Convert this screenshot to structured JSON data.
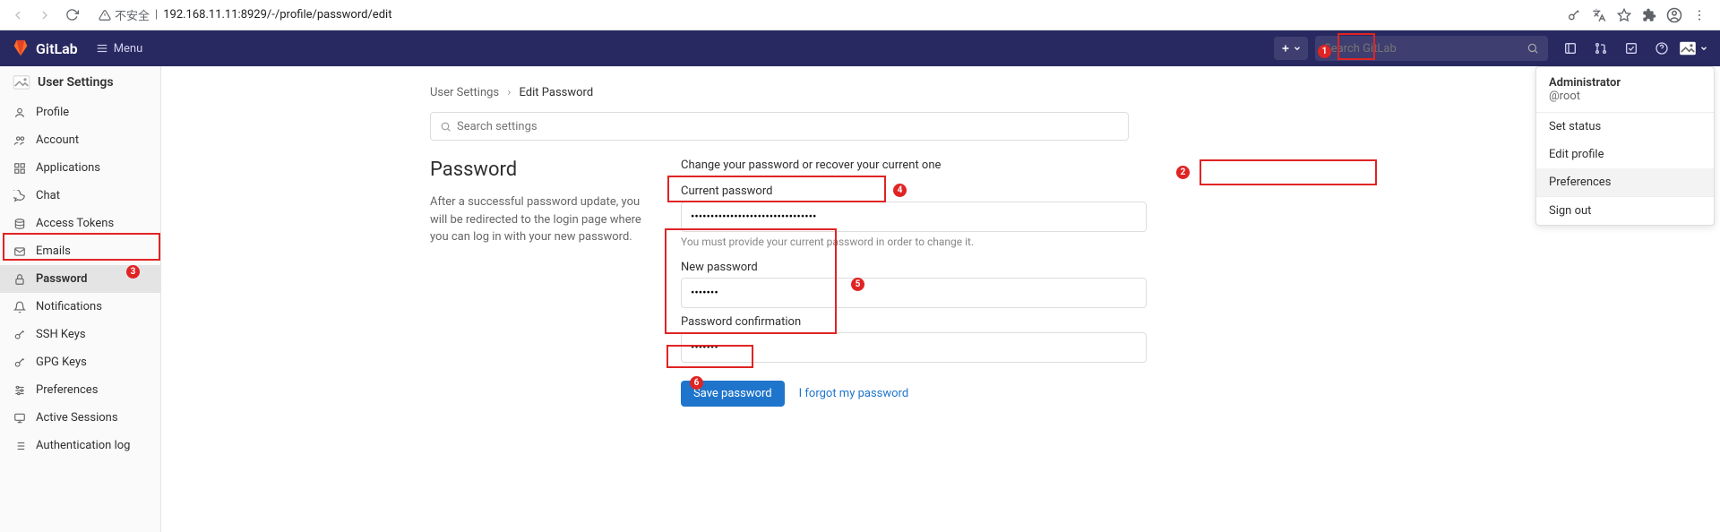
{
  "browser": {
    "insecure_label": "不安全",
    "url": "192.168.11.11:8929/-/profile/password/edit"
  },
  "nav": {
    "brand": "GitLab",
    "menu": "Menu",
    "search_placeholder": "Search GitLab"
  },
  "sidebar": {
    "title": "User Settings",
    "items": [
      {
        "label": "Profile"
      },
      {
        "label": "Account"
      },
      {
        "label": "Applications"
      },
      {
        "label": "Chat"
      },
      {
        "label": "Access Tokens"
      },
      {
        "label": "Emails"
      },
      {
        "label": "Password"
      },
      {
        "label": "Notifications"
      },
      {
        "label": "SSH Keys"
      },
      {
        "label": "GPG Keys"
      },
      {
        "label": "Preferences"
      },
      {
        "label": "Active Sessions"
      },
      {
        "label": "Authentication log"
      }
    ]
  },
  "breadcrumb": {
    "root": "User Settings",
    "current": "Edit Password"
  },
  "search_settings_placeholder": "Search settings",
  "section": {
    "heading": "Password",
    "intro": "After a successful password update, you will be redirected to the login page where you can log in with your new password.",
    "topdesc": "Change your password or recover your current one",
    "current_label": "Current password",
    "current_value": "••••••••••••••••••••••••••••••••",
    "current_help": "You must provide your current password in order to change it.",
    "new_label": "New password",
    "new_value": "•••••••",
    "confirm_label": "Password confirmation",
    "confirm_value": "•••••••",
    "save_btn": "Save password",
    "forgot": "I forgot my password"
  },
  "dropdown": {
    "name": "Administrator",
    "user": "@root",
    "items": [
      "Set status",
      "Edit profile",
      "Preferences",
      "Sign out"
    ]
  },
  "annotations": {
    "n1": "1",
    "n2": "2",
    "n3": "3",
    "n4": "4",
    "n5": "5",
    "n6": "6"
  }
}
